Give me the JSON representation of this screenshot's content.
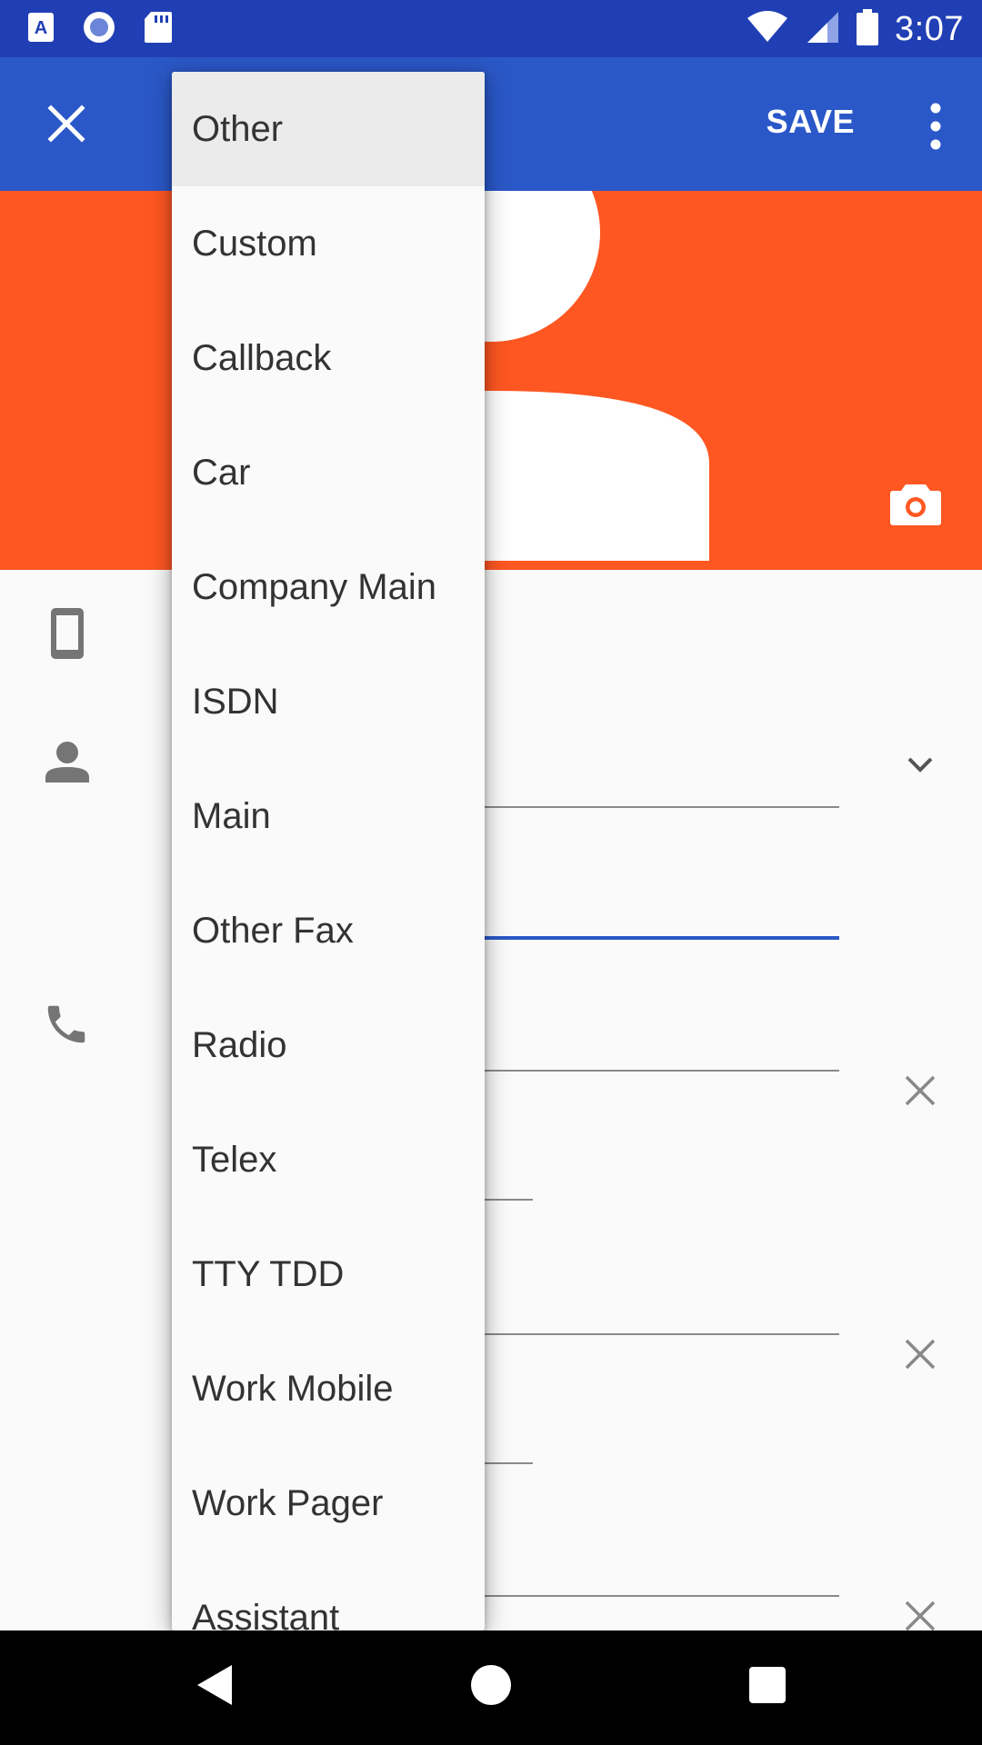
{
  "status_bar": {
    "time": "3:07",
    "left_icons": [
      "accessibility-a-icon",
      "circle-app-icon",
      "sd-card-icon"
    ],
    "right_icons": [
      "wifi-icon",
      "cell-signal-icon",
      "battery-icon"
    ]
  },
  "app_bar": {
    "close_icon": "close-icon",
    "save_label": "SAVE",
    "overflow_icon": "more-vert-icon"
  },
  "header": {
    "background_color": "#ff5722",
    "camera_icon": "camera-icon"
  },
  "form": {
    "icons": [
      "phone-device-icon",
      "person-icon",
      "phone-icon"
    ]
  },
  "dropdown": {
    "items": [
      "Other",
      "Custom",
      "Callback",
      "Car",
      "Company Main",
      "ISDN",
      "Main",
      "Other Fax",
      "Radio",
      "Telex",
      "TTY TDD",
      "Work Mobile",
      "Work Pager",
      "Assistant"
    ],
    "selected_index": 0
  },
  "colors": {
    "status_bar": "#213fb4",
    "app_bar": "#2b58c8",
    "accent": "#2b58c8",
    "header": "#ff5722"
  }
}
